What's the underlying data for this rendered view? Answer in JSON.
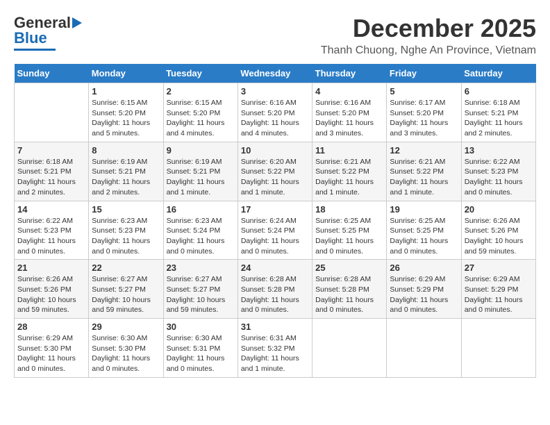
{
  "header": {
    "logo_general": "General",
    "logo_blue": "Blue",
    "month_title": "December 2025",
    "location": "Thanh Chuong, Nghe An Province, Vietnam"
  },
  "days_of_week": [
    "Sunday",
    "Monday",
    "Tuesday",
    "Wednesday",
    "Thursday",
    "Friday",
    "Saturday"
  ],
  "weeks": [
    [
      {
        "day": "",
        "sunrise": "",
        "sunset": "",
        "daylight": ""
      },
      {
        "day": "1",
        "sunrise": "6:15 AM",
        "sunset": "5:20 PM",
        "daylight": "11 hours and 5 minutes."
      },
      {
        "day": "2",
        "sunrise": "6:15 AM",
        "sunset": "5:20 PM",
        "daylight": "11 hours and 4 minutes."
      },
      {
        "day": "3",
        "sunrise": "6:16 AM",
        "sunset": "5:20 PM",
        "daylight": "11 hours and 4 minutes."
      },
      {
        "day": "4",
        "sunrise": "6:16 AM",
        "sunset": "5:20 PM",
        "daylight": "11 hours and 3 minutes."
      },
      {
        "day": "5",
        "sunrise": "6:17 AM",
        "sunset": "5:20 PM",
        "daylight": "11 hours and 3 minutes."
      },
      {
        "day": "6",
        "sunrise": "6:18 AM",
        "sunset": "5:21 PM",
        "daylight": "11 hours and 2 minutes."
      }
    ],
    [
      {
        "day": "7",
        "sunrise": "6:18 AM",
        "sunset": "5:21 PM",
        "daylight": "11 hours and 2 minutes."
      },
      {
        "day": "8",
        "sunrise": "6:19 AM",
        "sunset": "5:21 PM",
        "daylight": "11 hours and 2 minutes."
      },
      {
        "day": "9",
        "sunrise": "6:19 AM",
        "sunset": "5:21 PM",
        "daylight": "11 hours and 1 minute."
      },
      {
        "day": "10",
        "sunrise": "6:20 AM",
        "sunset": "5:22 PM",
        "daylight": "11 hours and 1 minute."
      },
      {
        "day": "11",
        "sunrise": "6:21 AM",
        "sunset": "5:22 PM",
        "daylight": "11 hours and 1 minute."
      },
      {
        "day": "12",
        "sunrise": "6:21 AM",
        "sunset": "5:22 PM",
        "daylight": "11 hours and 1 minute."
      },
      {
        "day": "13",
        "sunrise": "6:22 AM",
        "sunset": "5:23 PM",
        "daylight": "11 hours and 0 minutes."
      }
    ],
    [
      {
        "day": "14",
        "sunrise": "6:22 AM",
        "sunset": "5:23 PM",
        "daylight": "11 hours and 0 minutes."
      },
      {
        "day": "15",
        "sunrise": "6:23 AM",
        "sunset": "5:23 PM",
        "daylight": "11 hours and 0 minutes."
      },
      {
        "day": "16",
        "sunrise": "6:23 AM",
        "sunset": "5:24 PM",
        "daylight": "11 hours and 0 minutes."
      },
      {
        "day": "17",
        "sunrise": "6:24 AM",
        "sunset": "5:24 PM",
        "daylight": "11 hours and 0 minutes."
      },
      {
        "day": "18",
        "sunrise": "6:25 AM",
        "sunset": "5:25 PM",
        "daylight": "11 hours and 0 minutes."
      },
      {
        "day": "19",
        "sunrise": "6:25 AM",
        "sunset": "5:25 PM",
        "daylight": "11 hours and 0 minutes."
      },
      {
        "day": "20",
        "sunrise": "6:26 AM",
        "sunset": "5:26 PM",
        "daylight": "10 hours and 59 minutes."
      }
    ],
    [
      {
        "day": "21",
        "sunrise": "6:26 AM",
        "sunset": "5:26 PM",
        "daylight": "10 hours and 59 minutes."
      },
      {
        "day": "22",
        "sunrise": "6:27 AM",
        "sunset": "5:27 PM",
        "daylight": "10 hours and 59 minutes."
      },
      {
        "day": "23",
        "sunrise": "6:27 AM",
        "sunset": "5:27 PM",
        "daylight": "10 hours and 59 minutes."
      },
      {
        "day": "24",
        "sunrise": "6:28 AM",
        "sunset": "5:28 PM",
        "daylight": "11 hours and 0 minutes."
      },
      {
        "day": "25",
        "sunrise": "6:28 AM",
        "sunset": "5:28 PM",
        "daylight": "11 hours and 0 minutes."
      },
      {
        "day": "26",
        "sunrise": "6:29 AM",
        "sunset": "5:29 PM",
        "daylight": "11 hours and 0 minutes."
      },
      {
        "day": "27",
        "sunrise": "6:29 AM",
        "sunset": "5:29 PM",
        "daylight": "11 hours and 0 minutes."
      }
    ],
    [
      {
        "day": "28",
        "sunrise": "6:29 AM",
        "sunset": "5:30 PM",
        "daylight": "11 hours and 0 minutes."
      },
      {
        "day": "29",
        "sunrise": "6:30 AM",
        "sunset": "5:30 PM",
        "daylight": "11 hours and 0 minutes."
      },
      {
        "day": "30",
        "sunrise": "6:30 AM",
        "sunset": "5:31 PM",
        "daylight": "11 hours and 0 minutes."
      },
      {
        "day": "31",
        "sunrise": "6:31 AM",
        "sunset": "5:32 PM",
        "daylight": "11 hours and 1 minute."
      },
      {
        "day": "",
        "sunrise": "",
        "sunset": "",
        "daylight": ""
      },
      {
        "day": "",
        "sunrise": "",
        "sunset": "",
        "daylight": ""
      },
      {
        "day": "",
        "sunrise": "",
        "sunset": "",
        "daylight": ""
      }
    ]
  ]
}
